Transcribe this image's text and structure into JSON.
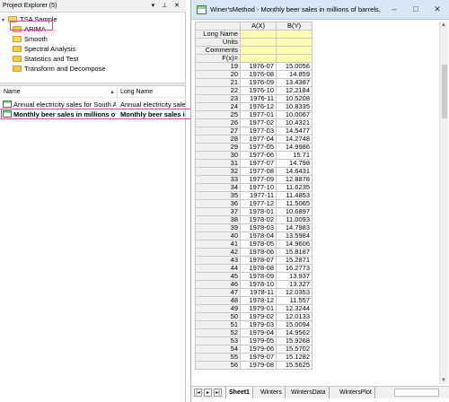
{
  "project_explorer": {
    "title": "Project Explorer (5)",
    "title_icons": "▾ ⊥ ✕",
    "tree": {
      "root": "TSA Sample",
      "folders": [
        "ARIMA",
        "Smooth",
        "Spectral Analysis",
        "Statistics and Test",
        "Transform and Decompose"
      ]
    },
    "list_headers": {
      "name": "Name",
      "long_name": "Long Name",
      "sort": "▲"
    },
    "list_rows": [
      {
        "name": "Annual electricity sales for South A...",
        "long_name": "Annual electricity sales"
      },
      {
        "name": "Monthly beer sales in millions of ...",
        "long_name": "Monthly beer sales in"
      }
    ]
  },
  "workbook": {
    "title": "Winer'sMethod - Monthly beer sales in millions of barrels, 01/1975 ...",
    "buttons": {
      "minimize": "–",
      "restore": "□",
      "close": "✕"
    },
    "columns": [
      "A(X)",
      "B(Y)"
    ],
    "meta_rows": [
      "Long Name",
      "Units",
      "Comments",
      "F(x)="
    ],
    "rows": [
      {
        "n": "19",
        "x": "1976-07",
        "y": "15.0056"
      },
      {
        "n": "20",
        "x": "1976-08",
        "y": "14.859"
      },
      {
        "n": "21",
        "x": "1976-09",
        "y": "13.4387"
      },
      {
        "n": "22",
        "x": "1976-10",
        "y": "12.2184"
      },
      {
        "n": "23",
        "x": "1976-11",
        "y": "10.5208"
      },
      {
        "n": "24",
        "x": "1976-12",
        "y": "10.8335"
      },
      {
        "n": "25",
        "x": "1977-01",
        "y": "10.0067"
      },
      {
        "n": "26",
        "x": "1977-02",
        "y": "10.4321"
      },
      {
        "n": "27",
        "x": "1977-03",
        "y": "14.5477"
      },
      {
        "n": "28",
        "x": "1977-04",
        "y": "14.2748"
      },
      {
        "n": "29",
        "x": "1977-05",
        "y": "14.9986"
      },
      {
        "n": "30",
        "x": "1977-06",
        "y": "15.71"
      },
      {
        "n": "31",
        "x": "1977-07",
        "y": "14.798"
      },
      {
        "n": "32",
        "x": "1977-08",
        "y": "14.6431"
      },
      {
        "n": "33",
        "x": "1977-09",
        "y": "12.8878"
      },
      {
        "n": "34",
        "x": "1977-10",
        "y": "11.6235"
      },
      {
        "n": "35",
        "x": "1977-11",
        "y": "11.4853"
      },
      {
        "n": "36",
        "x": "1977-12",
        "y": "11.5065"
      },
      {
        "n": "37",
        "x": "1978-01",
        "y": "10.6897"
      },
      {
        "n": "38",
        "x": "1978-02",
        "y": "11.0093"
      },
      {
        "n": "39",
        "x": "1978-03",
        "y": "14.7983"
      },
      {
        "n": "40",
        "x": "1978-04",
        "y": "13.5984"
      },
      {
        "n": "41",
        "x": "1978-05",
        "y": "14.9606"
      },
      {
        "n": "42",
        "x": "1978-06",
        "y": "15.8187"
      },
      {
        "n": "43",
        "x": "1978-07",
        "y": "15.2871"
      },
      {
        "n": "44",
        "x": "1978-08",
        "y": "16.2773"
      },
      {
        "n": "45",
        "x": "1978-09",
        "y": "13.937"
      },
      {
        "n": "46",
        "x": "1978-10",
        "y": "13.327"
      },
      {
        "n": "47",
        "x": "1978-11",
        "y": "12.0353"
      },
      {
        "n": "48",
        "x": "1978-12",
        "y": "11.557"
      },
      {
        "n": "49",
        "x": "1979-01",
        "y": "12.3244"
      },
      {
        "n": "50",
        "x": "1979-02",
        "y": "12.0133"
      },
      {
        "n": "51",
        "x": "1979-03",
        "y": "15.0094"
      },
      {
        "n": "52",
        "x": "1979-04",
        "y": "14.9562"
      },
      {
        "n": "53",
        "x": "1979-05",
        "y": "15.9268"
      },
      {
        "n": "54",
        "x": "1979-06",
        "y": "15.5702"
      },
      {
        "n": "55",
        "x": "1979-07",
        "y": "15.1282"
      },
      {
        "n": "56",
        "x": "1979-08",
        "y": "15.5625"
      }
    ],
    "sheet_nav": [
      "|◂",
      "▸",
      "▸|"
    ],
    "tabs": [
      "Sheet1",
      "Winters",
      "WintersData",
      "WintersPlot"
    ]
  }
}
